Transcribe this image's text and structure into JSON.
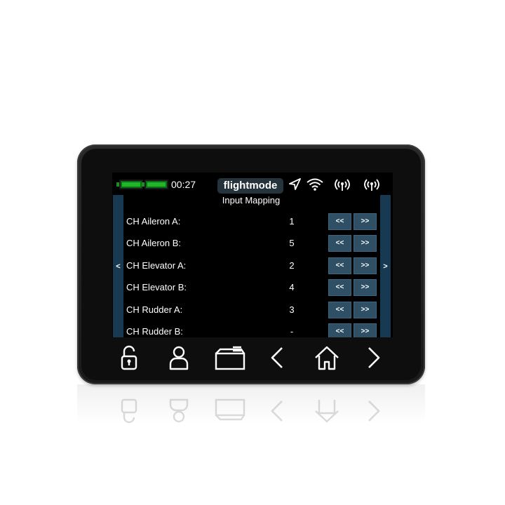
{
  "status": {
    "time": "00:27",
    "mode_label": "flightmode",
    "icons": [
      "battery-icon",
      "battery-icon",
      "location-arrow-icon",
      "wifi-icon",
      "antenna-icon",
      "antenna-icon"
    ]
  },
  "page": {
    "title": "Input Mapping",
    "prev_arrow": "<",
    "next_arrow": ">"
  },
  "rows": [
    {
      "label": "CH Aileron A:",
      "value": "1",
      "dec": "<<",
      "inc": ">>"
    },
    {
      "label": "CH Aileron B:",
      "value": "5",
      "dec": "<<",
      "inc": ">>"
    },
    {
      "label": "CH Elevator A:",
      "value": "2",
      "dec": "<<",
      "inc": ">>"
    },
    {
      "label": "CH Elevator B:",
      "value": "4",
      "dec": "<<",
      "inc": ">>"
    },
    {
      "label": "CH Rudder A:",
      "value": "3",
      "dec": "<<",
      "inc": ">>"
    },
    {
      "label": "CH Rudder B:",
      "value": "-",
      "dec": "<<",
      "inc": ">>"
    }
  ],
  "nav": [
    "unlock-icon",
    "user-icon",
    "model-icon",
    "back-icon",
    "home-icon",
    "forward-icon"
  ],
  "colors": {
    "battery_green": "#22b52c",
    "badge_bg": "#25333d",
    "side_bar": "#173a52",
    "button_bg": "#2e4f64"
  }
}
